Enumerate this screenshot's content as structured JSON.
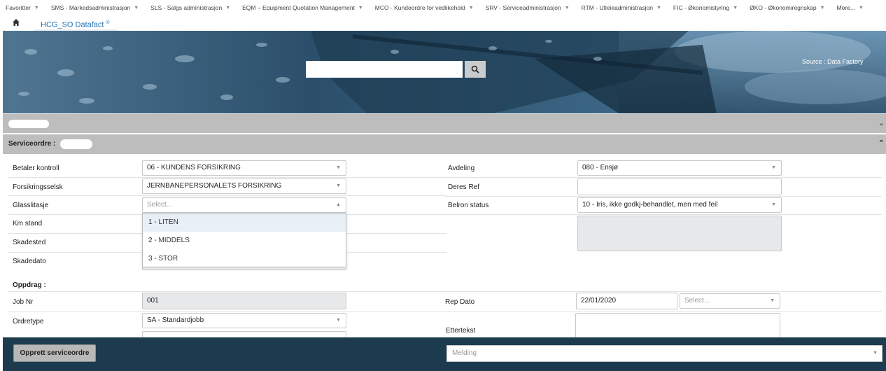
{
  "top_menu": [
    {
      "label": "Favoritter"
    },
    {
      "label": "SMS - Markedsadministrasjon"
    },
    {
      "label": "SLS - Salgs administrasjon"
    },
    {
      "label": "EQM – Equipment Quotation Management"
    },
    {
      "label": "MCO - Kundeordre for vedlikehold"
    },
    {
      "label": "SRV - Serviceadministrasjon"
    },
    {
      "label": "RTM - Utleieadministrasjon"
    },
    {
      "label": "FIC - Økonomistyring"
    },
    {
      "label": "ØKO - Økonomiregnskap"
    },
    {
      "label": "More..."
    }
  ],
  "tab": {
    "label": "HCG_SO Datafact",
    "superscript": "©"
  },
  "banner": {
    "search_value": "",
    "source_text": "Source : Data Factory"
  },
  "sections": {
    "first_title": "",
    "service_title": "Serviceordre :"
  },
  "form": {
    "betaler_label": "Betaler kontroll",
    "betaler_value": "06 - KUNDENS FORSIKRING",
    "forsikring_label": "Forsikringsselsk",
    "forsikring_value": "JERNBANEPERSONALETS FORSIKRING",
    "glass_label": "Glasslitasje",
    "glass_placeholder": "Select...",
    "km_label": "Km stand",
    "skadested_label": "Skadested",
    "skadedato_label": "Skadedato",
    "avdeling_label": "Avdeling",
    "avdeling_value": "080 - Ensjø",
    "deres_ref_label": "Deres Ref",
    "deres_ref_value": "",
    "belron_label": "Belron status",
    "belron_value": "10 - Iris, ikke godkj-behandlet, men med feil",
    "glass_options": [
      "1 - LITEN",
      "2 - MIDDELS",
      "3 - STOR"
    ]
  },
  "oppdrag": {
    "title": "Oppdrag :",
    "job_label": "Job Nr",
    "job_value": "001",
    "ordretype_label": "Ordretype",
    "ordretype_value": "SA - Standardjobb",
    "rep_dato_label": "Rep Dato",
    "rep_dato_value": "22/01/2020",
    "rep_select_placeholder": "Select...",
    "ettertekst_label": "Ettertekst"
  },
  "footer": {
    "create_button": "Opprett serviceordre",
    "message_placeholder": "Melding"
  },
  "colors": {
    "footer_bg": "#1d3b4f",
    "section_bar": "#bdbdbd",
    "link": "#1a6fb3"
  }
}
